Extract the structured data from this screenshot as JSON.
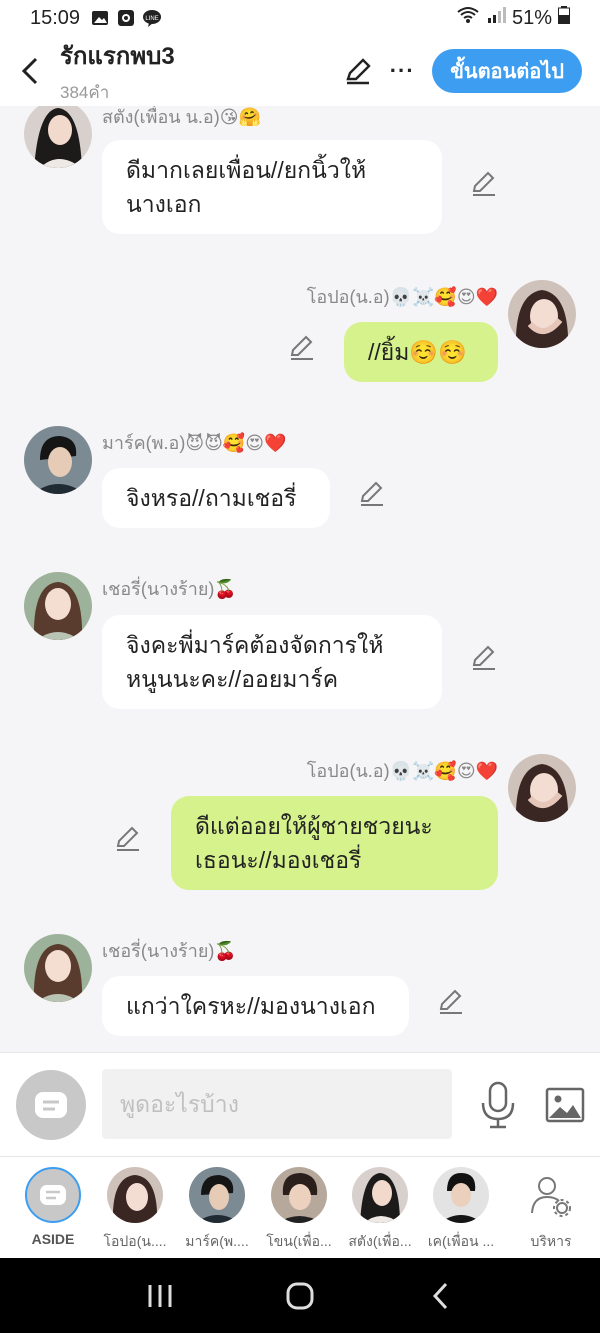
{
  "status": {
    "time": "15:09",
    "battery": "51%"
  },
  "header": {
    "title": "รักแรกพบ3",
    "word_count": "384คำ",
    "next_label": "ขั้นตอนต่อไป"
  },
  "messages": [
    {
      "side": "left",
      "name": "สตัง(เพื่อน น.อ)😘🤗",
      "text_lines": [
        "ดีมากเลยเพื่อน//ยกนิ้วให้",
        "นางเอก"
      ]
    },
    {
      "side": "right",
      "name": "โอปอ(น.อ)💀☠️🥰😍❤️",
      "text_lines": [
        "//ยิ้ม☺️☺️"
      ]
    },
    {
      "side": "left",
      "name": "มาร์ค(พ.อ)😈😈🥰😍❤️",
      "text_lines": [
        "จิงหรอ//ถามเชอรี่"
      ]
    },
    {
      "side": "left",
      "name": "เชอรี่(นางร้าย)🍒",
      "text_lines": [
        "จิงคะพี่มาร์คต้องจัดการให้",
        "หนูนนะคะ//ออยมาร์ค"
      ]
    },
    {
      "side": "right",
      "name": "โอปอ(น.อ)💀☠️🥰😍❤️",
      "text_lines": [
        "ดีแต่ออยให้ผู้ชายชวยนะ",
        "เธอนะ//มองเชอรี่"
      ]
    },
    {
      "side": "left",
      "name": "เชอรี่(นางร้าย)🍒",
      "text_lines": [
        "แกว่าใครหะ//มองนางเอก"
      ]
    }
  ],
  "input": {
    "placeholder": "พูดอะไรบ้าง"
  },
  "characters": [
    {
      "label": "ASIDE"
    },
    {
      "label": "โอปอ(น...."
    },
    {
      "label": "มาร์ค(พ...."
    },
    {
      "label": "โขน(เพื่อ..."
    },
    {
      "label": "สตัง(เพื่อ..."
    },
    {
      "label": "เค(เพื่อน ..."
    },
    {
      "label": "บริหาร"
    }
  ],
  "colors": {
    "accent": "#3d9ef1",
    "my_bubble": "#d6f28c",
    "background": "#f5f5f7"
  }
}
